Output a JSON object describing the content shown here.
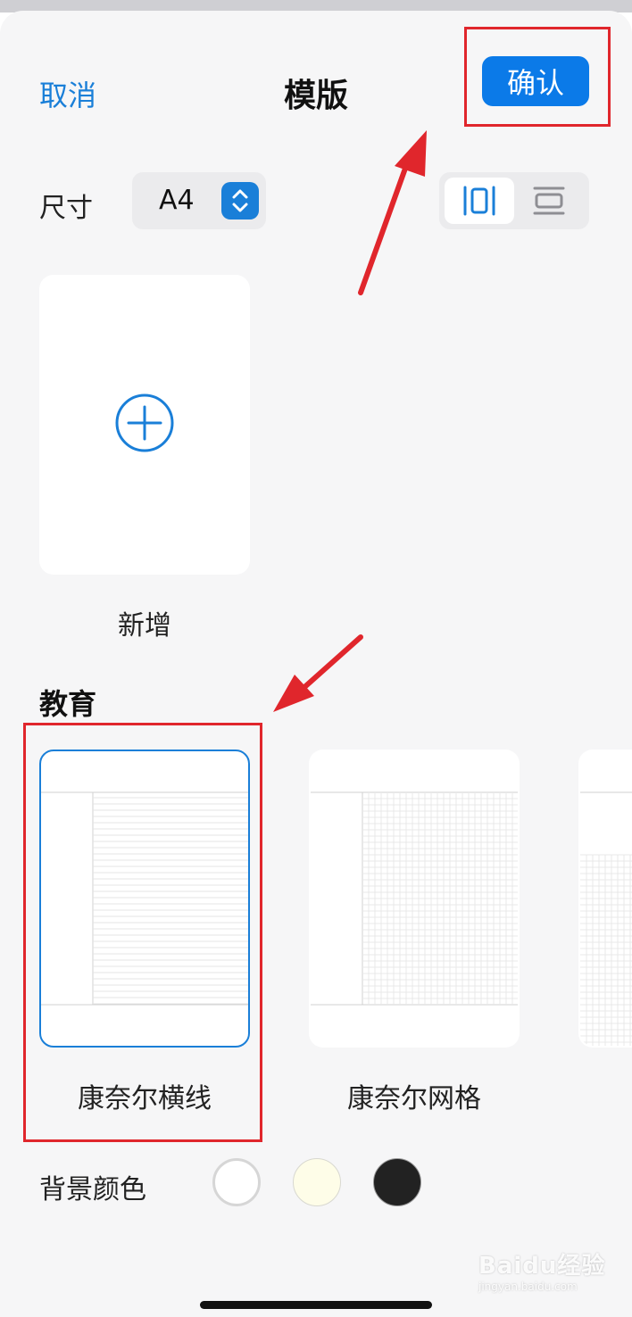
{
  "header": {
    "cancel_label": "取消",
    "title": "模版",
    "confirm_label": "确认"
  },
  "size": {
    "label": "尺寸",
    "value": "A4"
  },
  "orientation": {
    "options": [
      "portrait-icon",
      "landscape-icon"
    ],
    "selected": "portrait"
  },
  "new_template": {
    "label": "新增",
    "icon": "plus-circle-icon"
  },
  "section": {
    "title": "教育",
    "templates": [
      {
        "label": "康奈尔横线",
        "pattern": "lines",
        "selected": true
      },
      {
        "label": "康奈尔网格",
        "pattern": "grid",
        "selected": false
      },
      {
        "label": "",
        "pattern": "dots",
        "selected": false
      }
    ]
  },
  "background": {
    "label": "背景颜色",
    "colors": [
      "#ffffff",
      "#fefde8",
      "#222222"
    ],
    "selected": 0
  },
  "colors": {
    "accent": "#1a7fd8",
    "confirm_bg": "#0b7ae8",
    "annotation": "#e0262c"
  },
  "watermark": {
    "logo": "Baidu经验",
    "url": "jingyan.baidu.com"
  }
}
